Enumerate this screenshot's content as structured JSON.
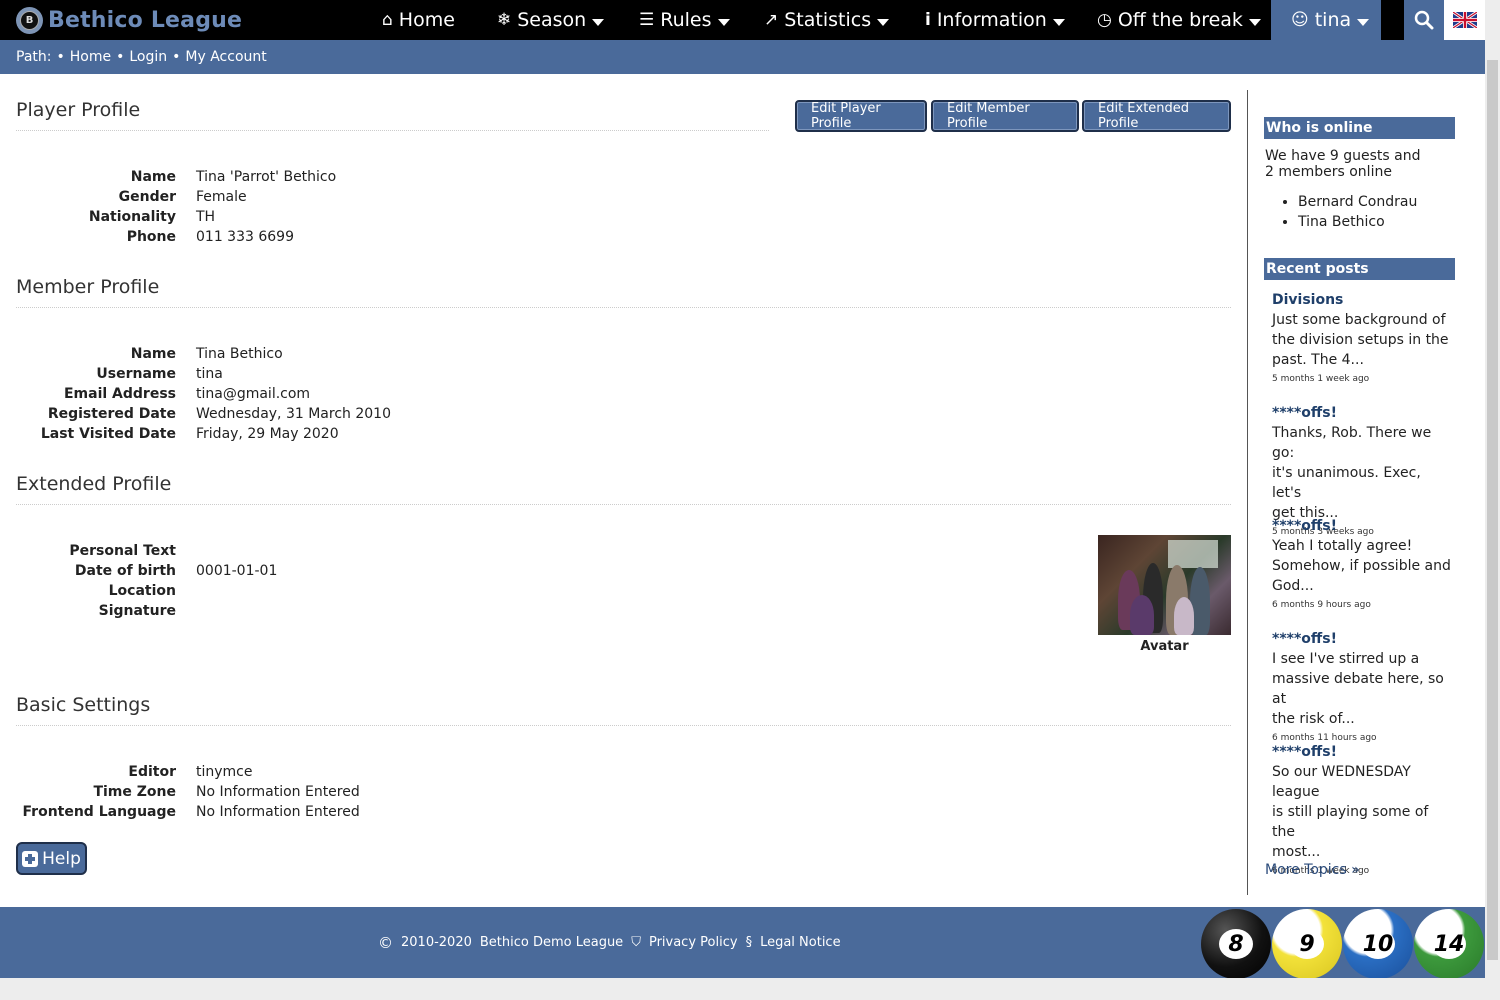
{
  "brand": {
    "logo_letter": "B",
    "name": "Bethico League"
  },
  "nav": {
    "items": [
      {
        "icon": "home-icon",
        "glyph": "⌂",
        "label": "Home"
      },
      {
        "icon": "snowflake-icon",
        "glyph": "❄",
        "label": "Season"
      },
      {
        "icon": "document-icon",
        "glyph": "☰",
        "label": "Rules"
      },
      {
        "icon": "chart-icon",
        "glyph": "↗",
        "label": "Statistics"
      },
      {
        "icon": "info-icon",
        "glyph": "i",
        "label": "Information"
      },
      {
        "icon": "clock-icon",
        "glyph": "◷",
        "label": "Off the break"
      }
    ],
    "user": {
      "icon": "user-icon",
      "label": "tina"
    }
  },
  "path": {
    "prefix": "Path:",
    "items": [
      "Home",
      "Login",
      "My Account"
    ]
  },
  "buttons": {
    "edit_player": "Edit Player Profile",
    "edit_member": "Edit Member Profile",
    "edit_extended": "Edit Extended Profile",
    "help": "Help"
  },
  "player_profile": {
    "title": "Player Profile",
    "fields": [
      {
        "label": "Name",
        "value": "Tina 'Parrot' Bethico"
      },
      {
        "label": "Gender",
        "value": "Female"
      },
      {
        "label": "Nationality",
        "value": "TH"
      },
      {
        "label": "Phone",
        "value": "011 333 6699"
      }
    ]
  },
  "member_profile": {
    "title": "Member Profile",
    "fields": [
      {
        "label": "Name",
        "value": "Tina Bethico"
      },
      {
        "label": "Username",
        "value": "tina"
      },
      {
        "label": "Email Address",
        "value": "tina@gmail.com"
      },
      {
        "label": "Registered Date",
        "value": "Wednesday, 31 March 2010"
      },
      {
        "label": "Last Visited Date",
        "value": "Friday, 29 May 2020"
      }
    ]
  },
  "extended_profile": {
    "title": "Extended Profile",
    "fields": [
      {
        "label": "Personal Text",
        "value": ""
      },
      {
        "label": "Date of birth",
        "value": "0001-01-01"
      },
      {
        "label": "Location",
        "value": ""
      },
      {
        "label": "Signature",
        "value": ""
      }
    ],
    "avatar_caption": "Avatar"
  },
  "basic_settings": {
    "title": "Basic Settings",
    "fields": [
      {
        "label": "Editor",
        "value": "tinymce"
      },
      {
        "label": "Time Zone",
        "value": "No Information Entered"
      },
      {
        "label": "Frontend Language",
        "value": "No Information Entered"
      }
    ]
  },
  "sidebar": {
    "online": {
      "title": "Who is online",
      "line1": "We have 9 guests and",
      "line2": "2 members online",
      "members": [
        "Bernard Condrau",
        "Tina Bethico"
      ]
    },
    "recent": {
      "title": "Recent posts",
      "posts": [
        {
          "title": "Divisions",
          "lines": [
            "Just some background of",
            "the division setups in the",
            "past. The 4..."
          ],
          "date": "5 months 1 week ago"
        },
        {
          "title": "****offs!",
          "lines": [
            "Thanks, Rob. There we go:",
            "it's unanimous. Exec, let's",
            "get this..."
          ],
          "date": "5 months 3 weeks ago"
        },
        {
          "title": "****offs!",
          "lines": [
            "Yeah I totally agree!",
            "Somehow, if possible and",
            "God..."
          ],
          "date": "6 months 9 hours ago"
        },
        {
          "title": "****offs!",
          "lines": [
            "I see I've stirred up a",
            "massive debate here, so at",
            "the risk of..."
          ],
          "date": "6 months 11 hours ago"
        },
        {
          "title": "****offs!",
          "lines": [
            "So our WEDNESDAY league",
            "is still playing some of the",
            "most..."
          ],
          "date": "6 months 1 week ago"
        }
      ],
      "more": "More Topics »"
    }
  },
  "footer": {
    "copyright_symbol": "©",
    "copyright": "2010-2020",
    "site": "Bethico Demo League",
    "privacy_symbol": "⛉",
    "privacy": "Privacy Policy",
    "legal_symbol": "§",
    "legal": "Legal Notice",
    "balls": [
      {
        "number": "8",
        "color": "#111111"
      },
      {
        "number": "9",
        "color": "#f3e23a"
      },
      {
        "number": "10",
        "color": "#2b6fc4"
      },
      {
        "number": "14",
        "color": "#3d9a3d"
      }
    ]
  },
  "colors": {
    "nav_bg": "#000000",
    "accent": "#4a6a9a",
    "brand_text": "#6d8bb8"
  }
}
